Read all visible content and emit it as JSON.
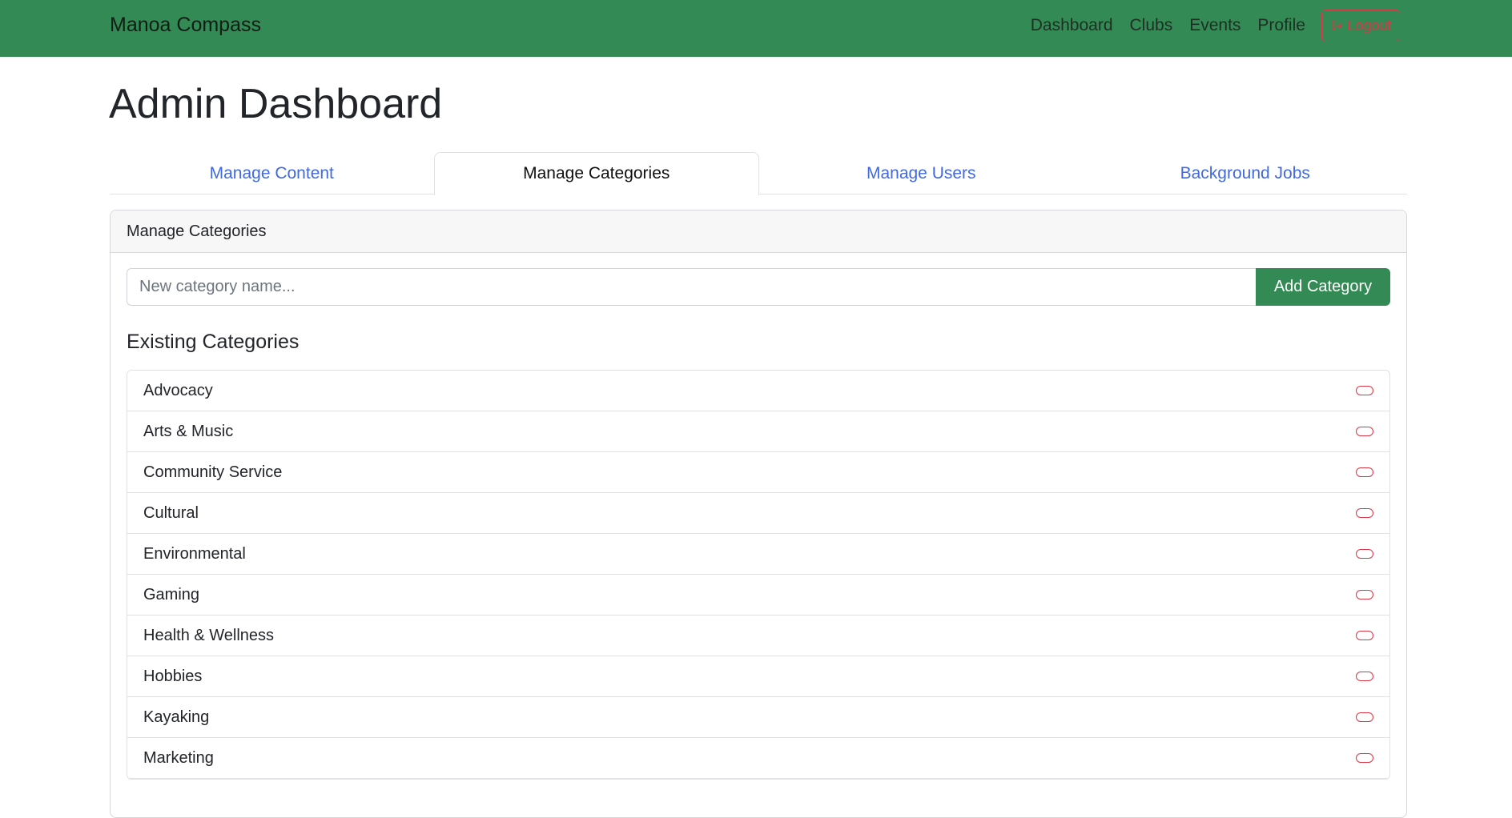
{
  "navbar": {
    "brand": "Manoa Compass",
    "links": [
      "Dashboard",
      "Clubs",
      "Events",
      "Profile"
    ],
    "logout_label": "Logout",
    "logout_icon": "logout-icon",
    "bg_color": "#348a54",
    "logout_color": "#dc3545"
  },
  "page": {
    "title": "Admin Dashboard"
  },
  "tabs": [
    {
      "label": "Manage Content",
      "active": false
    },
    {
      "label": "Manage Categories",
      "active": true
    },
    {
      "label": "Manage Users",
      "active": false
    },
    {
      "label": "Background Jobs",
      "active": false
    }
  ],
  "card": {
    "header": "Manage Categories",
    "input_placeholder": "New category name...",
    "input_value": "",
    "add_button_label": "Add Category",
    "section_title": "Existing Categories",
    "categories": [
      "Advocacy",
      "Arts & Music",
      "Community Service",
      "Cultural",
      "Environmental",
      "Gaming",
      "Health & Wellness",
      "Hobbies",
      "Kayaking",
      "Marketing"
    ],
    "delete_icon": "delete-pill-icon"
  }
}
